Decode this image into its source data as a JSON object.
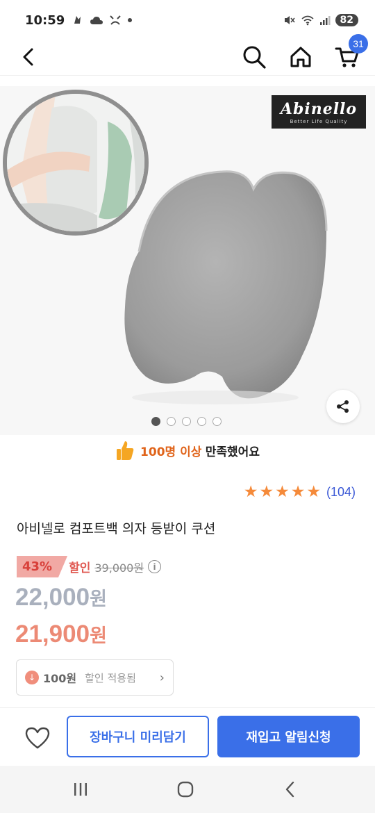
{
  "status_bar": {
    "time": "10:59",
    "left_icons": [
      "notification-icon",
      "cloud-icon",
      "alert-icon",
      "dot-icon"
    ],
    "right_icons": [
      "mute-icon",
      "wifi-icon",
      "signal-icon"
    ],
    "battery": "82"
  },
  "header": {
    "cart_count": "31"
  },
  "product_image": {
    "brand_name": "Abinello",
    "brand_tagline": "Better Life Quality",
    "slide_count": 5,
    "active_slide": 0
  },
  "satisfaction": {
    "highlight": "100명 이상",
    "rest": "만족했어요"
  },
  "rating": {
    "stars": 5,
    "review_count": "(104)"
  },
  "product": {
    "title": "아비넬로 컴포트백 의자 등받이 쿠션"
  },
  "pricing": {
    "discount_percent": "43%",
    "discount_label": "할인",
    "original_price": "39,000원",
    "price_number": "22,000",
    "price_unit": "원",
    "sale_price_number": "21,900",
    "sale_price_unit": "원"
  },
  "coupon": {
    "amount": "100원",
    "text": "할인 적용됨"
  },
  "actions": {
    "cart_label": "장바구니 미리담기",
    "restock_label": "재입고 알림신청"
  },
  "colors": {
    "accent_blue": "#3a6fe8",
    "discount_red": "#d8413b",
    "sale_price": "#ec8a75",
    "star_orange": "#f58a3a",
    "satisfaction_orange": "#e0641b"
  }
}
